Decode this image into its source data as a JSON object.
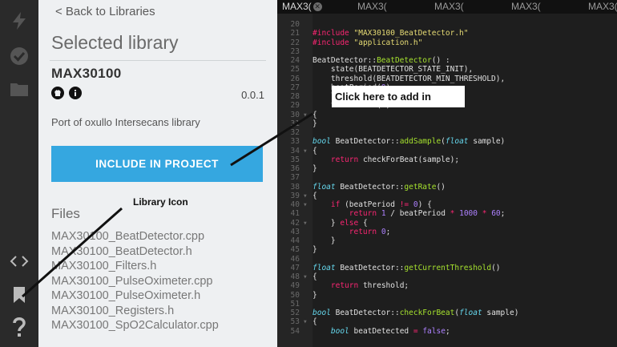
{
  "panel": {
    "back_label": "< Back to Libraries",
    "heading": "Selected library",
    "library_name": "MAX30100",
    "version": "0.0.1",
    "description": "Port of oxullo Intersecans library",
    "include_label": "INCLUDE IN PROJECT",
    "files_heading": "Files",
    "files": [
      "MAX30100_BeatDetector.cpp",
      "MAX30100_BeatDetector.h",
      "MAX30100_Filters.h",
      "MAX30100_PulseOximeter.cpp",
      "MAX30100_PulseOximeter.h",
      "MAX30100_Registers.h",
      "MAX30100_SpO2Calculator.cpp"
    ]
  },
  "editor": {
    "tabs": [
      "MAX3(",
      "MAX3(",
      "MAX3(",
      "MAX3(",
      "MAX3("
    ]
  },
  "annotations": {
    "click_here": "Click here to add in",
    "library_icon": "Library Icon"
  },
  "rail_icons": [
    "flash-icon",
    "verify-icon",
    "folder-icon",
    "code-icon",
    "bookmark-icon",
    "help-icon"
  ]
}
